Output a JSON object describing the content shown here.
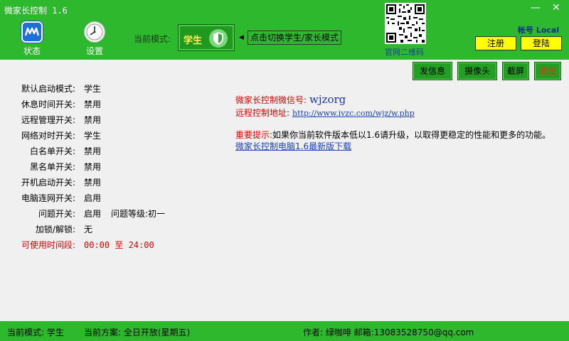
{
  "window": {
    "title": "微家长控制 1.6",
    "minimize": "—",
    "close": "✕"
  },
  "nav": {
    "status": {
      "label": "状态",
      "icon": "app-logo-icon"
    },
    "settings": {
      "label": "设置",
      "icon": "clock-icon"
    }
  },
  "mode": {
    "label": "当前模式:",
    "value": "学生",
    "switch_hint": "点击切换学生/家长模式"
  },
  "qr": {
    "label": "官网二维码"
  },
  "account": {
    "label": "帐号 Local",
    "register": "注册",
    "login": "登陆"
  },
  "actions": {
    "send_message": "发信息",
    "camera": "摄像头",
    "screenshot": "截屏",
    "exit": "退出"
  },
  "settings_list": [
    {
      "key": "默认启动模式:",
      "value": "学生"
    },
    {
      "key": "休息时间开关:",
      "value": "禁用"
    },
    {
      "key": "远程管理开关:",
      "value": "禁用"
    },
    {
      "key": "网络对时开关:",
      "value": "学生"
    },
    {
      "key": "白名单开关:",
      "value": "禁用"
    },
    {
      "key": "黑名单开关:",
      "value": "禁用"
    },
    {
      "key": "开机启动开关:",
      "value": "禁用"
    },
    {
      "key": "电脑连网开关:",
      "value": "启用"
    },
    {
      "key": "问题开关:",
      "value": "启用",
      "extra": "问题等级:初一"
    },
    {
      "key": "加锁/解锁:",
      "value": "无"
    },
    {
      "key": "可使用时间段:",
      "value": "00:00 至 24:00"
    }
  ],
  "info": {
    "wechat_label": "微家长控制微信号:",
    "wechat_value": "wjzorg",
    "remote_label": "远程控制地址:",
    "remote_url": "http://www.ivzc.com/wjz/w.php",
    "notice_label": "重要提示:",
    "notice_text": "如果你当前软件版本低以1.6请升级，以取得更稳定的性能和更多的功能。",
    "download_link": "微家长控制电脑1.6最新版下载"
  },
  "statusbar": {
    "mode": "当前模式:  学生",
    "plan": "当前方案: 全日开放(星期五)",
    "author": "作者: 绿咖啡 邮箱:13083528750@qq.com"
  },
  "colors": {
    "header_green": "#2db82d",
    "button_green": "#22a022",
    "accent_yellow": "#ffff00",
    "alert_red": "#e00000",
    "link_blue": "#1a3fc0"
  }
}
